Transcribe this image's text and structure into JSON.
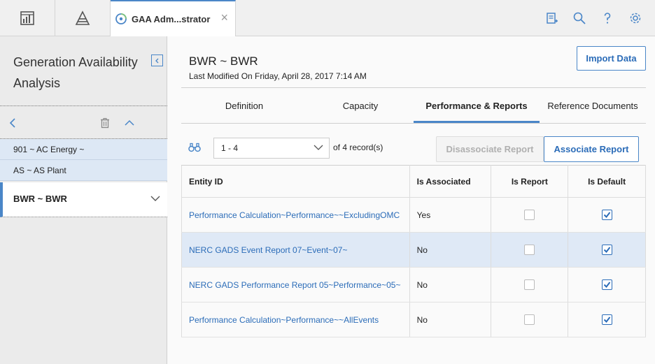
{
  "topbar": {
    "tab_title": "GAA Adm...strator"
  },
  "left": {
    "app_title": "Generation Availability Analysis",
    "items": [
      {
        "label": "901 ~ AC Energy ~"
      },
      {
        "label": "AS ~ AS Plant"
      },
      {
        "label": "BWR ~ BWR"
      }
    ]
  },
  "main": {
    "title": "BWR ~ BWR",
    "subtitle": "Last Modified On Friday, April 28, 2017 7:14 AM",
    "import_label": "Import Data",
    "tabs": [
      "Definition",
      "Capacity",
      "Performance & Reports",
      "Reference Documents"
    ],
    "pager": "1 - 4",
    "record_count": "of 4 record(s)",
    "disassociate_label": "Disassociate Report",
    "associate_label": "Associate Report",
    "columns": [
      "Entity ID",
      "Is Associated",
      "Is Report",
      "Is Default"
    ],
    "rows": [
      {
        "entity": "Performance Calculation~Performance~~ExcludingOMC",
        "associated": "Yes"
      },
      {
        "entity": "NERC GADS Event Report 07~Event~07~",
        "associated": "No"
      },
      {
        "entity": "NERC GADS Performance Report 05~Performance~05~",
        "associated": "No"
      },
      {
        "entity": "Performance Calculation~Performance~~AllEvents",
        "associated": "No"
      }
    ]
  },
  "colors": {
    "accent": "#4a86c8",
    "link": "#2b6cb8",
    "highlight": "#dfe9f6"
  }
}
